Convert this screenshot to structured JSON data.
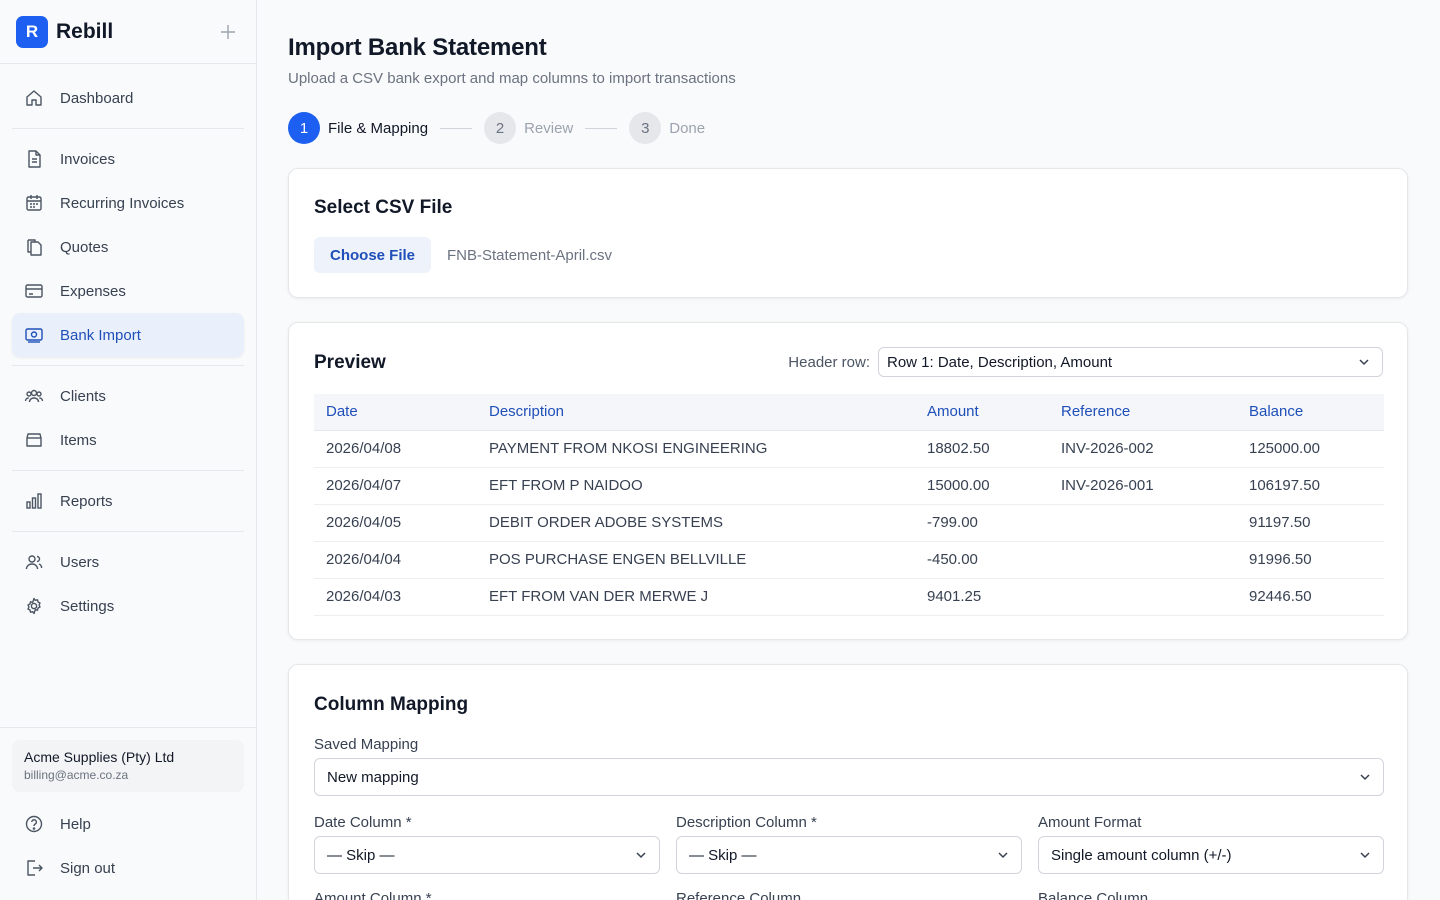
{
  "app": {
    "name": "Rebill",
    "logo_letter": "R"
  },
  "sidebar": {
    "items": [
      {
        "label": "Dashboard",
        "icon": "home-icon"
      },
      {
        "label": "Invoices",
        "icon": "document-icon"
      },
      {
        "label": "Recurring Invoices",
        "icon": "calendar-icon"
      },
      {
        "label": "Quotes",
        "icon": "copy-icon"
      },
      {
        "label": "Expenses",
        "icon": "card-icon"
      },
      {
        "label": "Bank Import",
        "icon": "banknote-icon",
        "active": true
      },
      {
        "label": "Clients",
        "icon": "people-icon"
      },
      {
        "label": "Items",
        "icon": "archive-icon"
      },
      {
        "label": "Reports",
        "icon": "bar-chart-icon"
      },
      {
        "label": "Users",
        "icon": "users-icon"
      },
      {
        "label": "Settings",
        "icon": "gear-icon"
      }
    ],
    "account": {
      "name": "Acme Supplies (Pty) Ltd",
      "email": "billing@acme.co.za"
    },
    "bottom": [
      {
        "label": "Help",
        "icon": "help-icon"
      },
      {
        "label": "Sign out",
        "icon": "sign-out-icon"
      }
    ]
  },
  "page": {
    "title": "Import Bank Statement",
    "subtitle": "Upload a CSV bank export and map columns to import transactions"
  },
  "stepper": {
    "steps": [
      {
        "number": "1",
        "label": "File & Mapping",
        "active": true
      },
      {
        "number": "2",
        "label": "Review",
        "active": false
      },
      {
        "number": "3",
        "label": "Done",
        "active": false
      }
    ]
  },
  "file_card": {
    "title": "Select CSV File",
    "button_label": "Choose File",
    "file_name": "FNB-Statement-April.csv"
  },
  "preview": {
    "title": "Preview",
    "header_row_label": "Header row:",
    "header_row_value": "Row 1: Date, Description, Amount",
    "columns": [
      "Date",
      "Description",
      "Amount",
      "Reference",
      "Balance"
    ],
    "rows": [
      [
        "2026/04/08",
        "PAYMENT FROM NKOSI ENGINEERING",
        "18802.50",
        "INV-2026-002",
        "125000.00"
      ],
      [
        "2026/04/07",
        "EFT FROM P NAIDOO",
        "15000.00",
        "INV-2026-001",
        "106197.50"
      ],
      [
        "2026/04/05",
        "DEBIT ORDER ADOBE SYSTEMS",
        "-799.00",
        "",
        "91197.50"
      ],
      [
        "2026/04/04",
        "POS PURCHASE ENGEN BELLVILLE",
        "-450.00",
        "",
        "91996.50"
      ],
      [
        "2026/04/03",
        "EFT FROM VAN DER MERWE J",
        "9401.25",
        "",
        "92446.50"
      ]
    ]
  },
  "mapping": {
    "title": "Column Mapping",
    "saved_mapping_label": "Saved Mapping",
    "saved_mapping_value": "New mapping",
    "date_label": "Date Column *",
    "date_value": "— Skip —",
    "description_label": "Description Column *",
    "description_value": "— Skip —",
    "amount_format_label": "Amount Format",
    "amount_format_value": "Single amount column (+/-)",
    "amount_column_label": "Amount Column *",
    "reference_column_label": "Reference Column",
    "balance_column_label": "Balance Column"
  }
}
